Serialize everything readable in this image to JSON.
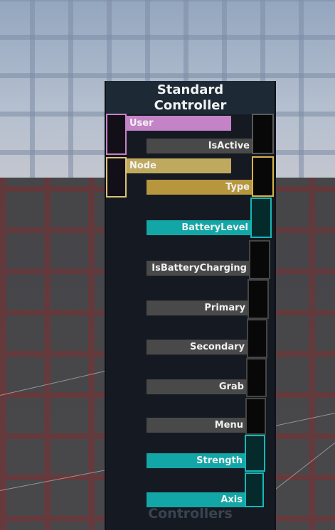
{
  "node": {
    "title_line1": "Standard",
    "title_line2": "Controller",
    "footer": "Controllers",
    "inputs": [
      {
        "label": "User",
        "color": "#c483c6"
      },
      {
        "label": "Node",
        "color": "#cbb86c"
      }
    ],
    "outputs": [
      {
        "label": "IsActive",
        "color": "#4a4a4a"
      },
      {
        "label": "Type",
        "color": "#c0a043"
      },
      {
        "label": "BatteryLevel",
        "color": "#13a6a6"
      },
      {
        "label": "IsBatteryCharging",
        "color": "#4a4a4a"
      },
      {
        "label": "Primary",
        "color": "#4a4a4a"
      },
      {
        "label": "Secondary",
        "color": "#4a4a4a"
      },
      {
        "label": "Grab",
        "color": "#4a4a4a"
      },
      {
        "label": "Menu",
        "color": "#4a4a4a"
      },
      {
        "label": "Strength",
        "color": "#13a6a6"
      },
      {
        "label": "Axis",
        "color": "#13a6a6"
      }
    ]
  }
}
